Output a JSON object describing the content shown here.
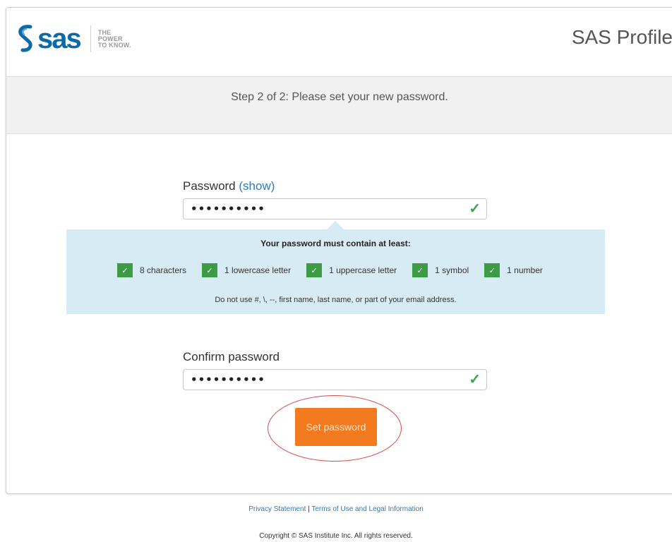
{
  "header": {
    "logo_word": "sas",
    "tagline": [
      "THE",
      "POWER",
      "TO KNOW."
    ],
    "app_title": "SAS Profile"
  },
  "step": {
    "text": "Step 2 of 2: Please set your new password."
  },
  "password": {
    "label": "Password",
    "show_label": "(show)",
    "value": "••••••••••",
    "check": "✓"
  },
  "requirements": {
    "title": "Your password must contain at least:",
    "items": [
      {
        "label": "8 characters",
        "met": true
      },
      {
        "label": "1 lowercase letter",
        "met": true
      },
      {
        "label": "1 uppercase letter",
        "met": true
      },
      {
        "label": "1 symbol",
        "met": true
      },
      {
        "label": "1 number",
        "met": true
      }
    ],
    "checkmark": "✓",
    "note": "Do not use #, \\, --, first name, last name, or part of your email address."
  },
  "confirm": {
    "label": "Confirm password",
    "value": "••••••••••",
    "check": "✓"
  },
  "submit": {
    "label": "Set password"
  },
  "footer": {
    "privacy": "Privacy Statement",
    "separator": "|",
    "terms": "Terms of Use and Legal Information",
    "copyright": "Copyright © SAS Institute Inc. All rights reserved."
  },
  "colors": {
    "brand_blue": "#0d6aa8",
    "accent_orange": "#f47a20",
    "success_green": "#3d9b45",
    "panel_blue": "#d7ebf5",
    "annotation_red": "#d94848"
  }
}
